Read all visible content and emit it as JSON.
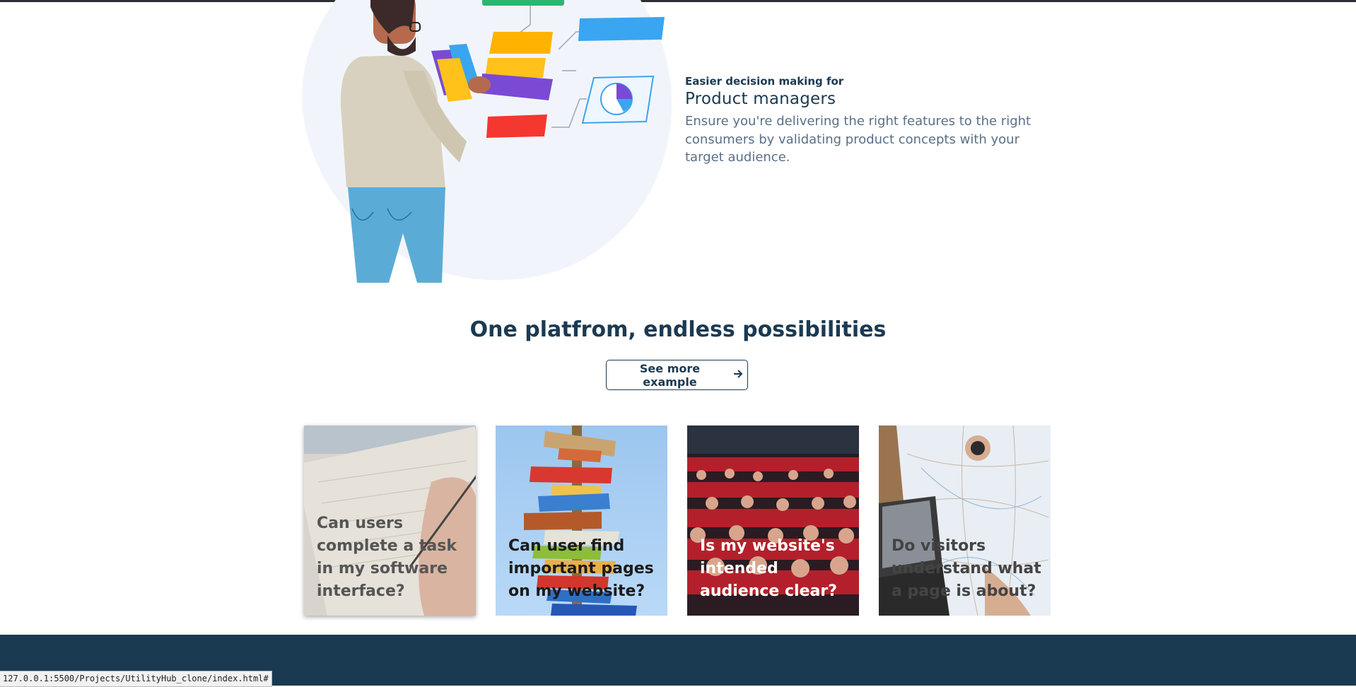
{
  "feature": {
    "kicker": "Easier decision making for",
    "title": "Product managers",
    "description": "Ensure you're delivering the right features to the right consumers by validating product concepts with your target audience."
  },
  "section": {
    "title": "One platfrom, endless possibilities",
    "button_label": "See more example",
    "button_icon": "arrow-right-icon"
  },
  "cards": [
    {
      "caption": "Can users complete a task in my software interface?"
    },
    {
      "caption": "Can user find important pages on my website?"
    },
    {
      "caption": "Is my website's intended audience clear?"
    },
    {
      "caption": "Do visitors understand what a page is about?"
    }
  ],
  "status_bar": {
    "url": "127.0.0.1:5500/Projects/UtilityHub_clone/index.html#"
  }
}
